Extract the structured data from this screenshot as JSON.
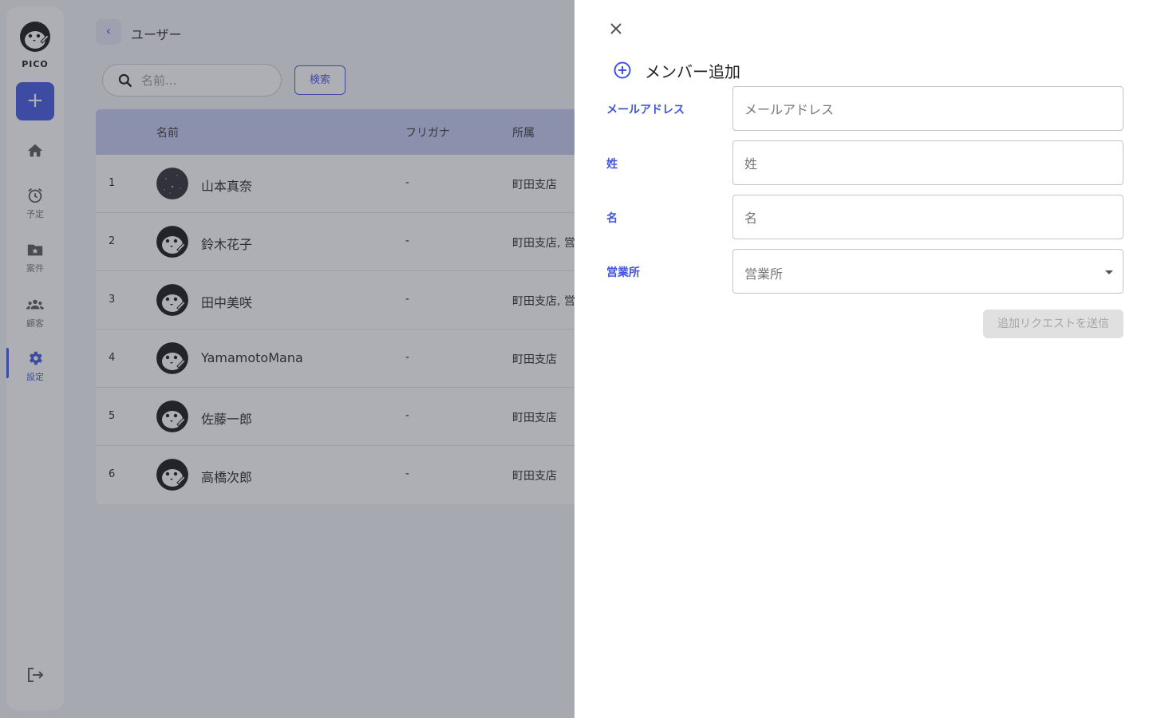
{
  "app": {
    "logo_text": "PICO"
  },
  "sidebar": {
    "add_icon": "plus-icon",
    "items": [
      {
        "icon": "home-icon",
        "label": ""
      },
      {
        "icon": "alarm-clock-icon",
        "label": "予定"
      },
      {
        "icon": "folder-star-icon",
        "label": "案件"
      },
      {
        "icon": "people-icon",
        "label": "顧客"
      },
      {
        "icon": "gear-icon",
        "label": "設定",
        "active": true
      }
    ],
    "logout_icon": "logout-icon"
  },
  "header": {
    "title": "ユーザー"
  },
  "search": {
    "placeholder": "名前...",
    "button_label": "検索"
  },
  "table": {
    "columns": [
      "名前",
      "フリガナ",
      "所属"
    ],
    "rows": [
      {
        "index": "1",
        "name": "山本真奈",
        "kana": "-",
        "office": "町田支店",
        "avatar": "photo"
      },
      {
        "index": "2",
        "name": "鈴木花子",
        "kana": "-",
        "office": "町田支店, 営",
        "avatar": "penguin"
      },
      {
        "index": "3",
        "name": "田中美咲",
        "kana": "-",
        "office": "町田支店, 営",
        "avatar": "penguin"
      },
      {
        "index": "4",
        "name": "YamamotoMana",
        "kana": "-",
        "office": "町田支店",
        "avatar": "penguin"
      },
      {
        "index": "5",
        "name": "佐藤一郎",
        "kana": "-",
        "office": "町田支店",
        "avatar": "penguin"
      },
      {
        "index": "6",
        "name": "高橋次郎",
        "kana": "-",
        "office": "町田支店",
        "avatar": "penguin"
      }
    ]
  },
  "drawer": {
    "title": "メンバー追加",
    "fields": {
      "email": {
        "label": "メールアドレス",
        "placeholder": "メールアドレス",
        "value": ""
      },
      "last_name": {
        "label": "姓",
        "placeholder": "姓",
        "value": ""
      },
      "first_name": {
        "label": "名",
        "placeholder": "名",
        "value": ""
      },
      "office": {
        "label": "営業所",
        "placeholder": "営業所"
      }
    },
    "submit_label": "追加リクエストを送信"
  },
  "colors": {
    "accent": "#3f54e0",
    "header_row": "#c5ccf1",
    "disabled_button": "#e0e0e0"
  }
}
